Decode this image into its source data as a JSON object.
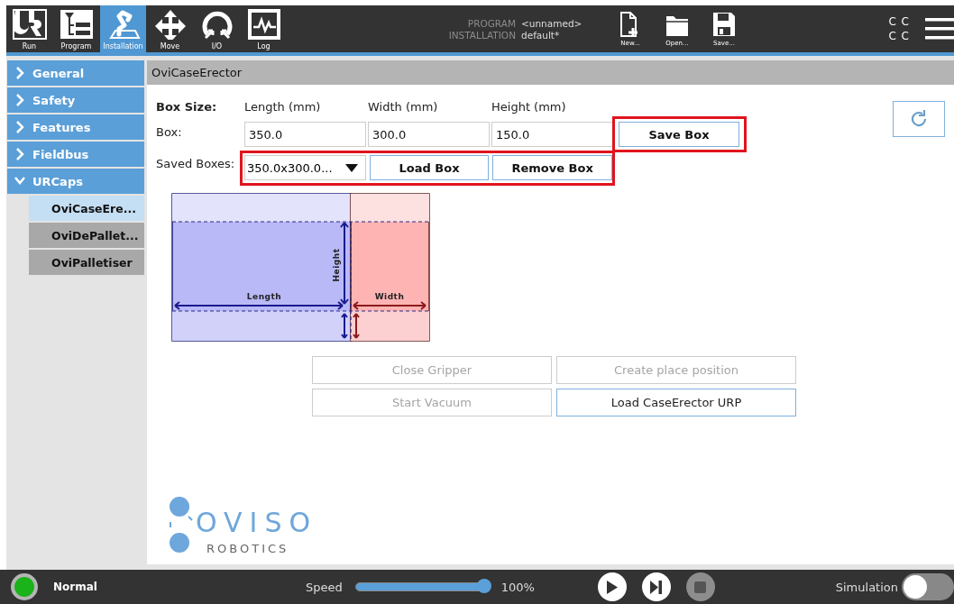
{
  "toolbar": {
    "tabs": [
      {
        "label": "Run",
        "kind": "ur",
        "selected": false
      },
      {
        "label": "Program",
        "kind": "tree",
        "selected": false
      },
      {
        "label": "Installation",
        "kind": "arm",
        "selected": true
      },
      {
        "label": "Move",
        "kind": "move",
        "selected": false
      },
      {
        "label": "I/O",
        "kind": "io",
        "selected": false
      },
      {
        "label": "Log",
        "kind": "log",
        "selected": false
      }
    ],
    "program_label": "PROGRAM",
    "program_name": "<unnamed>",
    "installation_label": "INSTALLATION",
    "installation_name": "default*",
    "file_buttons": [
      {
        "label": "New...",
        "kind": "new"
      },
      {
        "label": "Open...",
        "kind": "open"
      },
      {
        "label": "Save...",
        "kind": "save"
      }
    ],
    "status_glyphs": [
      "C C",
      "C C"
    ]
  },
  "sidebar": {
    "items": [
      {
        "label": "General",
        "expanded": false
      },
      {
        "label": "Safety",
        "expanded": false
      },
      {
        "label": "Features",
        "expanded": false
      },
      {
        "label": "Fieldbus",
        "expanded": false
      },
      {
        "label": "URCaps",
        "expanded": true,
        "children": [
          {
            "label": "OviCaseEre...",
            "selected": true
          },
          {
            "label": "OviDePallet...",
            "selected": false
          },
          {
            "label": "OviPalletiser",
            "selected": false
          }
        ]
      }
    ]
  },
  "panel": {
    "title": "OviCaseErector",
    "box_size_label": "Box Size:",
    "columns": [
      "Length (mm)",
      "Width (mm)",
      "Height (mm)"
    ],
    "box_label": "Box:",
    "box_values": [
      "350.0",
      "300.0",
      "150.0"
    ],
    "save_button": "Save Box",
    "saved_label": "Saved Boxes:",
    "saved_value": "350.0x300.0...",
    "load_button": "Load Box",
    "remove_button": "Remove Box",
    "diagram_labels": {
      "length": "Length",
      "width": "Width",
      "height": "Height"
    },
    "actions": [
      {
        "label": "Close Gripper",
        "disabled": true
      },
      {
        "label": "Create place position",
        "disabled": true
      },
      {
        "label": "Start Vacuum",
        "disabled": true
      },
      {
        "label": "Load CaseErector URP",
        "disabled": false
      }
    ],
    "logo": {
      "name": "OVISO",
      "tagline": "ROBOTICS"
    }
  },
  "footer": {
    "status": "Normal",
    "speed_label": "Speed",
    "speed": {
      "level": 1.0
    },
    "speed_reading": "100%",
    "controls": [
      {
        "kind": "play",
        "disabled": false
      },
      {
        "kind": "step",
        "disabled": false
      },
      {
        "kind": "stop",
        "disabled": true
      }
    ],
    "simulation_label": "Simulation",
    "simulation": {
      "on": false
    }
  }
}
